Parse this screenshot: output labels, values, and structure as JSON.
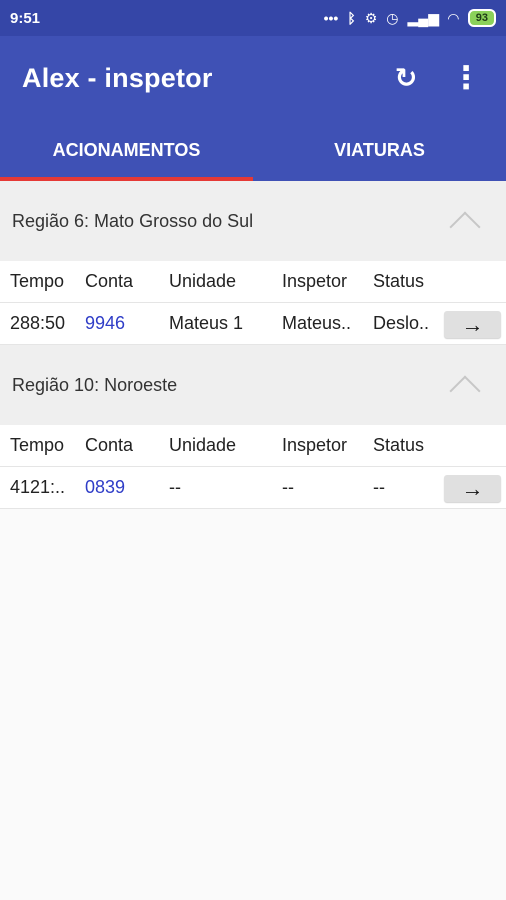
{
  "status_bar": {
    "time": "9:51",
    "battery": "93",
    "icons": [
      "dots-icon",
      "bluetooth-icon",
      "settings-off-icon",
      "alarm-icon",
      "signal-icon",
      "wifi-icon",
      "battery-icon"
    ]
  },
  "app_bar": {
    "title": "Alex - inspetor",
    "icons": [
      "refresh-icon",
      "more-vert-icon"
    ]
  },
  "tabs": [
    {
      "label": "ACIONAMENTOS",
      "active": true
    },
    {
      "label": "VIATURAS",
      "active": false
    }
  ],
  "regions": [
    {
      "title": "Região 6: Mato Grosso do Sul",
      "headers": [
        "Tempo",
        "Conta",
        "Unidade",
        "Inspetor",
        "Status"
      ],
      "rows": [
        {
          "tempo": "288:50",
          "conta": "9946",
          "unidade": "Mateus 1",
          "inspetor": "Mateus..",
          "status": "Deslo..",
          "action": "→"
        }
      ]
    },
    {
      "title": "Região 10: Noroeste",
      "headers": [
        "Tempo",
        "Conta",
        "Unidade",
        "Inspetor",
        "Status"
      ],
      "rows": [
        {
          "tempo": "4121:..",
          "conta": "0839",
          "unidade": "--",
          "inspetor": "--",
          "status": "--",
          "action": "→"
        }
      ]
    }
  ],
  "colors": {
    "primary": "#3f51b5",
    "status_bar": "#3546a7",
    "tab_indicator": "#e53935",
    "link": "#2f3dc7",
    "section_background": "#efefef"
  }
}
